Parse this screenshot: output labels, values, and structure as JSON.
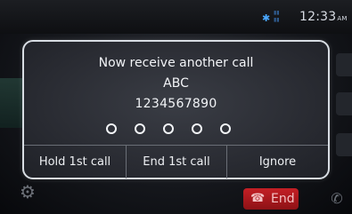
{
  "status_bar": {
    "bluetooth_icon": "bluetooth-icon",
    "clock_time": "12:33",
    "clock_ampm": "AM"
  },
  "background": {
    "end_button_label": "End",
    "end_button_icon": "phone-hangup-icon",
    "settings_icon": "gear-icon",
    "end_color": "#c41f25"
  },
  "dialog": {
    "title": "Now receive another call",
    "caller_name": "ABC",
    "caller_number": "1234567890",
    "indicator_count": 5,
    "buttons": [
      {
        "label": "Hold 1st call"
      },
      {
        "label": "End 1st call"
      },
      {
        "label": "Ignore"
      }
    ]
  }
}
